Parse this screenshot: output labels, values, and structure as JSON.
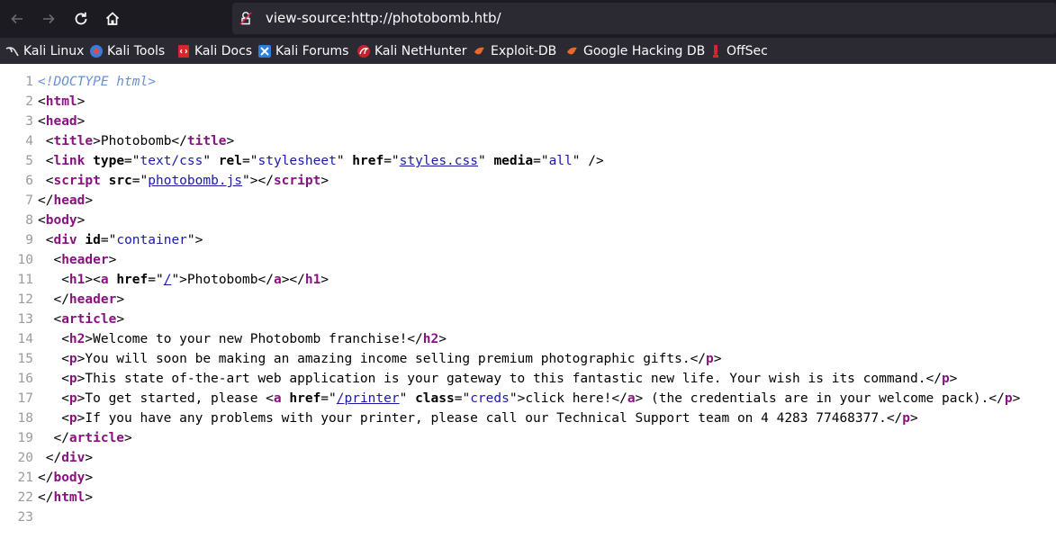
{
  "browser": {
    "url": "view-source:http://photobomb.htb/",
    "bookmarks": [
      {
        "label": "Kali Linux",
        "icon": "kali-dragon-icon"
      },
      {
        "label": "Kali Tools",
        "icon": "kali-tools-icon"
      },
      {
        "label": "Kali Docs",
        "icon": "kali-docs-icon"
      },
      {
        "label": "Kali Forums",
        "icon": "kali-forums-icon"
      },
      {
        "label": "Kali NetHunter",
        "icon": "nethunter-icon"
      },
      {
        "label": "Exploit-DB",
        "icon": "exploit-db-icon"
      },
      {
        "label": "Google Hacking DB",
        "icon": "ghdb-icon"
      },
      {
        "label": "OffSec",
        "icon": "offsec-icon"
      }
    ]
  },
  "source": {
    "lines": [
      [
        {
          "t": "<!DOCTYPE html>",
          "c": "dt"
        }
      ],
      [
        {
          "t": "<"
        },
        {
          "t": "html",
          "c": "tg"
        },
        {
          "t": ">"
        }
      ],
      [
        {
          "t": "<"
        },
        {
          "t": "head",
          "c": "tg"
        },
        {
          "t": ">"
        }
      ],
      [
        {
          "t": " <"
        },
        {
          "t": "title",
          "c": "tg"
        },
        {
          "t": ">Photobomb</"
        },
        {
          "t": "title",
          "c": "tg"
        },
        {
          "t": ">"
        }
      ],
      [
        {
          "t": " <"
        },
        {
          "t": "link",
          "c": "tg"
        },
        {
          "t": " "
        },
        {
          "t": "type",
          "c": "an"
        },
        {
          "t": "=\""
        },
        {
          "t": "text/css",
          "c": "av"
        },
        {
          "t": "\" "
        },
        {
          "t": "rel",
          "c": "an"
        },
        {
          "t": "=\""
        },
        {
          "t": "stylesheet",
          "c": "av"
        },
        {
          "t": "\" "
        },
        {
          "t": "href",
          "c": "an"
        },
        {
          "t": "=\""
        },
        {
          "t": "styles.css",
          "c": "lk"
        },
        {
          "t": "\" "
        },
        {
          "t": "media",
          "c": "an"
        },
        {
          "t": "=\""
        },
        {
          "t": "all",
          "c": "av"
        },
        {
          "t": "\" />"
        }
      ],
      [
        {
          "t": " <"
        },
        {
          "t": "script",
          "c": "tg"
        },
        {
          "t": " "
        },
        {
          "t": "src",
          "c": "an"
        },
        {
          "t": "=\""
        },
        {
          "t": "photobomb.js",
          "c": "lk"
        },
        {
          "t": "\"></"
        },
        {
          "t": "script",
          "c": "tg"
        },
        {
          "t": ">"
        }
      ],
      [
        {
          "t": "</"
        },
        {
          "t": "head",
          "c": "tg"
        },
        {
          "t": ">"
        }
      ],
      [
        {
          "t": "<"
        },
        {
          "t": "body",
          "c": "tg"
        },
        {
          "t": ">"
        }
      ],
      [
        {
          "t": " <"
        },
        {
          "t": "div",
          "c": "tg"
        },
        {
          "t": " "
        },
        {
          "t": "id",
          "c": "an"
        },
        {
          "t": "=\""
        },
        {
          "t": "container",
          "c": "av"
        },
        {
          "t": "\">"
        }
      ],
      [
        {
          "t": "  <"
        },
        {
          "t": "header",
          "c": "tg"
        },
        {
          "t": ">"
        }
      ],
      [
        {
          "t": "   <"
        },
        {
          "t": "h1",
          "c": "tg"
        },
        {
          "t": "><"
        },
        {
          "t": "a",
          "c": "tg"
        },
        {
          "t": " "
        },
        {
          "t": "href",
          "c": "an"
        },
        {
          "t": "=\""
        },
        {
          "t": "/",
          "c": "lk"
        },
        {
          "t": "\">Photobomb</"
        },
        {
          "t": "a",
          "c": "tg"
        },
        {
          "t": "></"
        },
        {
          "t": "h1",
          "c": "tg"
        },
        {
          "t": ">"
        }
      ],
      [
        {
          "t": "  </"
        },
        {
          "t": "header",
          "c": "tg"
        },
        {
          "t": ">"
        }
      ],
      [
        {
          "t": "  <"
        },
        {
          "t": "article",
          "c": "tg"
        },
        {
          "t": ">"
        }
      ],
      [
        {
          "t": "   <"
        },
        {
          "t": "h2",
          "c": "tg"
        },
        {
          "t": ">Welcome to your new Photobomb franchise!</"
        },
        {
          "t": "h2",
          "c": "tg"
        },
        {
          "t": ">"
        }
      ],
      [
        {
          "t": "   <"
        },
        {
          "t": "p",
          "c": "tg"
        },
        {
          "t": ">You will soon be making an amazing income selling premium photographic gifts.</"
        },
        {
          "t": "p",
          "c": "tg"
        },
        {
          "t": ">"
        }
      ],
      [
        {
          "t": "   <"
        },
        {
          "t": "p",
          "c": "tg"
        },
        {
          "t": ">This state of-the-art web application is your gateway to this fantastic new life. Your wish is its command.</"
        },
        {
          "t": "p",
          "c": "tg"
        },
        {
          "t": ">"
        }
      ],
      [
        {
          "t": "   <"
        },
        {
          "t": "p",
          "c": "tg"
        },
        {
          "t": ">To get started, please <"
        },
        {
          "t": "a",
          "c": "tg"
        },
        {
          "t": " "
        },
        {
          "t": "href",
          "c": "an"
        },
        {
          "t": "=\""
        },
        {
          "t": "/printer",
          "c": "lk"
        },
        {
          "t": "\" "
        },
        {
          "t": "class",
          "c": "an"
        },
        {
          "t": "=\""
        },
        {
          "t": "creds",
          "c": "av"
        },
        {
          "t": "\">click here!</"
        },
        {
          "t": "a",
          "c": "tg"
        },
        {
          "t": "> (the credentials are in your welcome pack).</"
        },
        {
          "t": "p",
          "c": "tg"
        },
        {
          "t": ">"
        }
      ],
      [
        {
          "t": "   <"
        },
        {
          "t": "p",
          "c": "tg"
        },
        {
          "t": ">If you have any problems with your printer, please call our Technical Support team on 4 4283 77468377.</"
        },
        {
          "t": "p",
          "c": "tg"
        },
        {
          "t": ">"
        }
      ],
      [
        {
          "t": "  </"
        },
        {
          "t": "article",
          "c": "tg"
        },
        {
          "t": ">"
        }
      ],
      [
        {
          "t": " </"
        },
        {
          "t": "div",
          "c": "tg"
        },
        {
          "t": ">"
        }
      ],
      [
        {
          "t": "</"
        },
        {
          "t": "body",
          "c": "tg"
        },
        {
          "t": ">"
        }
      ],
      [
        {
          "t": "</"
        },
        {
          "t": "html",
          "c": "tg"
        },
        {
          "t": ">"
        }
      ],
      []
    ]
  }
}
